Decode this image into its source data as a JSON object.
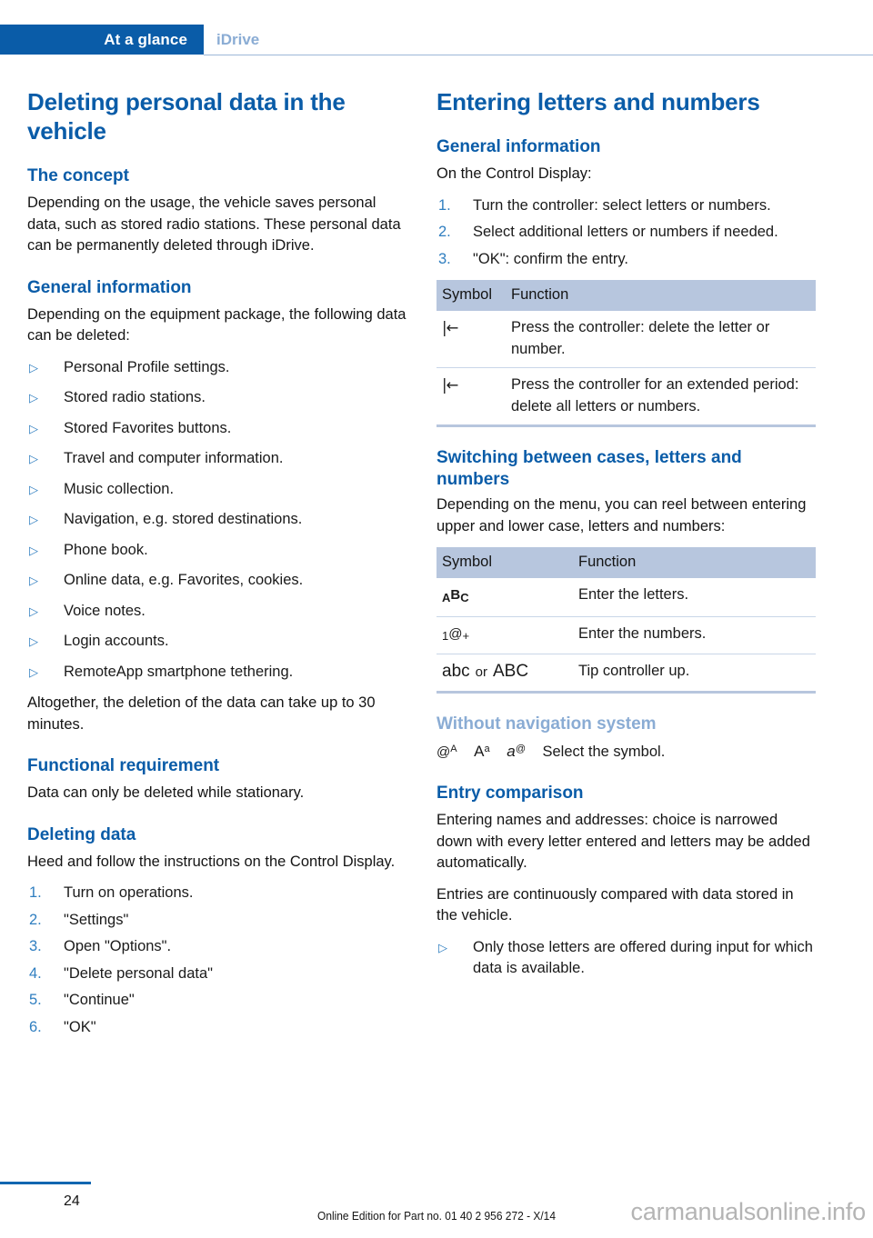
{
  "header": {
    "active_tab": "At a glance",
    "inactive_tab": "iDrive"
  },
  "colors": {
    "brand_blue": "#0a5ca8",
    "muted_blue": "#8aacd4",
    "table_header_bg": "#b7c6de",
    "marker_blue": "#2f7ec0"
  },
  "left_column": {
    "title": "Deleting personal data in the vehicle",
    "sections": [
      {
        "heading": "The concept",
        "paragraph": "Depending on the usage, the vehicle saves personal data, such as stored radio stations. These personal data can be permanently deleted through iDrive."
      },
      {
        "heading": "General information",
        "paragraph": "Depending on the equipment package, the following data can be deleted:",
        "bullets": [
          "Personal Profile settings.",
          "Stored radio stations.",
          "Stored Favorites buttons.",
          "Travel and computer information.",
          "Music collection.",
          "Navigation, e.g. stored destinations.",
          "Phone book.",
          "Online data, e.g. Favorites, cookies.",
          "Voice notes.",
          "Login accounts.",
          "RemoteApp smartphone tethering."
        ],
        "closing": "Altogether, the deletion of the data can take up to 30 minutes."
      },
      {
        "heading": "Functional requirement",
        "paragraph": "Data can only be deleted while stationary."
      },
      {
        "heading": "Deleting data",
        "paragraph": "Heed and follow the instructions on the Control Display.",
        "steps": [
          {
            "number": "1.",
            "text": "Turn on operations."
          },
          {
            "number": "2.",
            "text": "\"Settings\""
          },
          {
            "number": "3.",
            "text": "Open \"Options\"."
          },
          {
            "number": "4.",
            "text": "\"Delete personal data\""
          },
          {
            "number": "5.",
            "text": "\"Continue\""
          },
          {
            "number": "6.",
            "text": "\"OK\""
          }
        ]
      }
    ]
  },
  "right_column": {
    "title": "Entering letters and numbers",
    "general": {
      "heading": "General information",
      "paragraph": "On the Control Display:",
      "steps": [
        {
          "number": "1.",
          "text": "Turn the controller: select letters or numbers."
        },
        {
          "number": "2.",
          "text": "Select additional letters or numbers if needed."
        },
        {
          "number": "3.",
          "text": "\"OK\": confirm the entry."
        }
      ]
    },
    "table_delete": {
      "headers": [
        "Symbol",
        "Function"
      ],
      "rows": [
        {
          "symbol": "|←",
          "symbol_name": "backspace-icon",
          "function": "Press the controller: delete the letter or number."
        },
        {
          "symbol": "|←",
          "symbol_name": "backspace-icon",
          "function": "Press the controller for an extended period: delete all letters or numbers."
        }
      ]
    },
    "switching": {
      "heading": "Switching between cases, letters and numbers",
      "paragraph": "Depending on the menu, you can reel between entering upper and lower case, letters and numbers:"
    },
    "table_switching": {
      "headers": [
        "Symbol",
        "Function"
      ],
      "rows": [
        {
          "symbol": "ABC",
          "symbol_name": "letters-icon",
          "function": "Enter the letters."
        },
        {
          "symbol": "1@+",
          "symbol_name": "numbers-icon",
          "function": "Enter the numbers."
        },
        {
          "symbol": "abc or ABC",
          "symbol_name": "case-toggle-icon",
          "function": "Tip controller up."
        }
      ]
    },
    "without_nav": {
      "heading": "Without navigation system",
      "symbols": [
        "@A",
        "Aa",
        "a@"
      ],
      "text": "Select the symbol."
    },
    "entry_comparison": {
      "heading": "Entry comparison",
      "paragraph1": "Entering names and addresses: choice is narrowed down with every letter entered and letters may be added automatically.",
      "paragraph2": "Entries are continuously compared with data stored in the vehicle.",
      "bullets": [
        "Only those letters are offered during input for which data is available."
      ]
    }
  },
  "footer": {
    "page_number": "24",
    "edition": "Online Edition for Part no. 01 40 2 956 272 - X/14",
    "watermark": "carmanualsonline.info"
  }
}
